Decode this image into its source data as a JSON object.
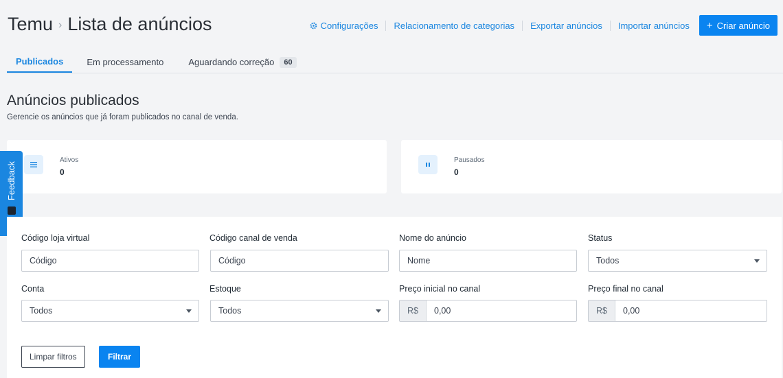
{
  "header": {
    "brand": "Temu",
    "separator": "›",
    "title": "Lista de anúncios",
    "actions": {
      "settings": "Configurações",
      "category_mapping": "Relacionamento de categorias",
      "export": "Exportar anúncios",
      "import": "Importar anúncios",
      "create": "Criar anúncio",
      "create_plus": "+"
    }
  },
  "tabs": [
    {
      "label": "Publicados",
      "active": true
    },
    {
      "label": "Em processamento"
    },
    {
      "label": "Aguardando correção",
      "badge": "60"
    }
  ],
  "section": {
    "title": "Anúncios publicados",
    "description": "Gerencie os anúncios que já foram publicados no canal de venda."
  },
  "stats": {
    "active": {
      "label": "Ativos",
      "value": "0",
      "icon": "list-icon"
    },
    "paused": {
      "label": "Pausados",
      "value": "0",
      "icon": "pause-icon"
    }
  },
  "feedback": {
    "label": "Feedback"
  },
  "filters": {
    "store_code": {
      "label": "Código loja virtual",
      "placeholder": "Código"
    },
    "channel_code": {
      "label": "Código canal de venda",
      "placeholder": "Código"
    },
    "ad_name": {
      "label": "Nome do anúncio",
      "placeholder": "Nome"
    },
    "status": {
      "label": "Status",
      "value": "Todos"
    },
    "account": {
      "label": "Conta",
      "value": "Todos"
    },
    "stock": {
      "label": "Estoque",
      "value": "Todos"
    },
    "price_min": {
      "label": "Preço inicial no canal",
      "prefix": "R$",
      "value": "0,00"
    },
    "price_max": {
      "label": "Preço final no canal",
      "prefix": "R$",
      "value": "0,00"
    },
    "clear_button": "Limpar filtros",
    "filter_button": "Filtrar"
  },
  "colors": {
    "accent": "#0a84f0",
    "link": "#1a86e0",
    "background": "#f3f4f6"
  }
}
